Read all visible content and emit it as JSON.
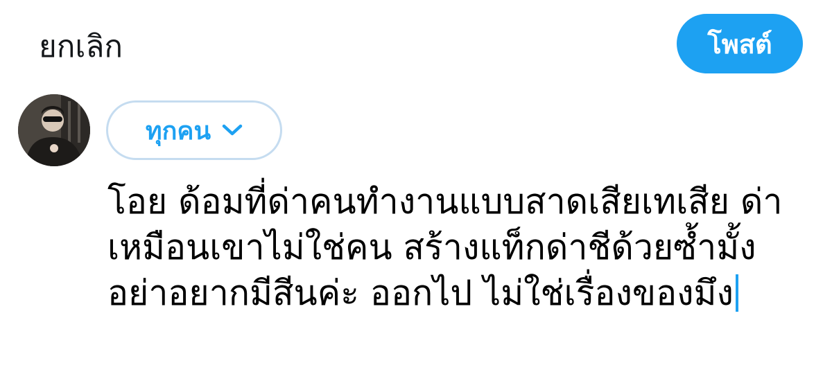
{
  "header": {
    "cancel_label": "ยกเลิก",
    "post_label": "โพสต์"
  },
  "composer": {
    "audience_label": "ทุกคน",
    "text_lines": [
      "โอย ด้อมที่ด่าคนทำงานแบบสาดเสียเทเสีย ด่า",
      "เหมือนเขาไม่ใช่คน สร้างแท็กด่าชีด้วยซ้ำมั้ง",
      "อย่าอยากมีสีนค่ะ ออกไป ไม่ใช่เรื่องของมึง"
    ]
  },
  "colors": {
    "accent": "#1da1f2",
    "audience_border": "#c5dcf0",
    "text": "#000000",
    "header_text": "#14171a"
  },
  "icons": {
    "audience_chevron": "chevron-down-icon"
  }
}
